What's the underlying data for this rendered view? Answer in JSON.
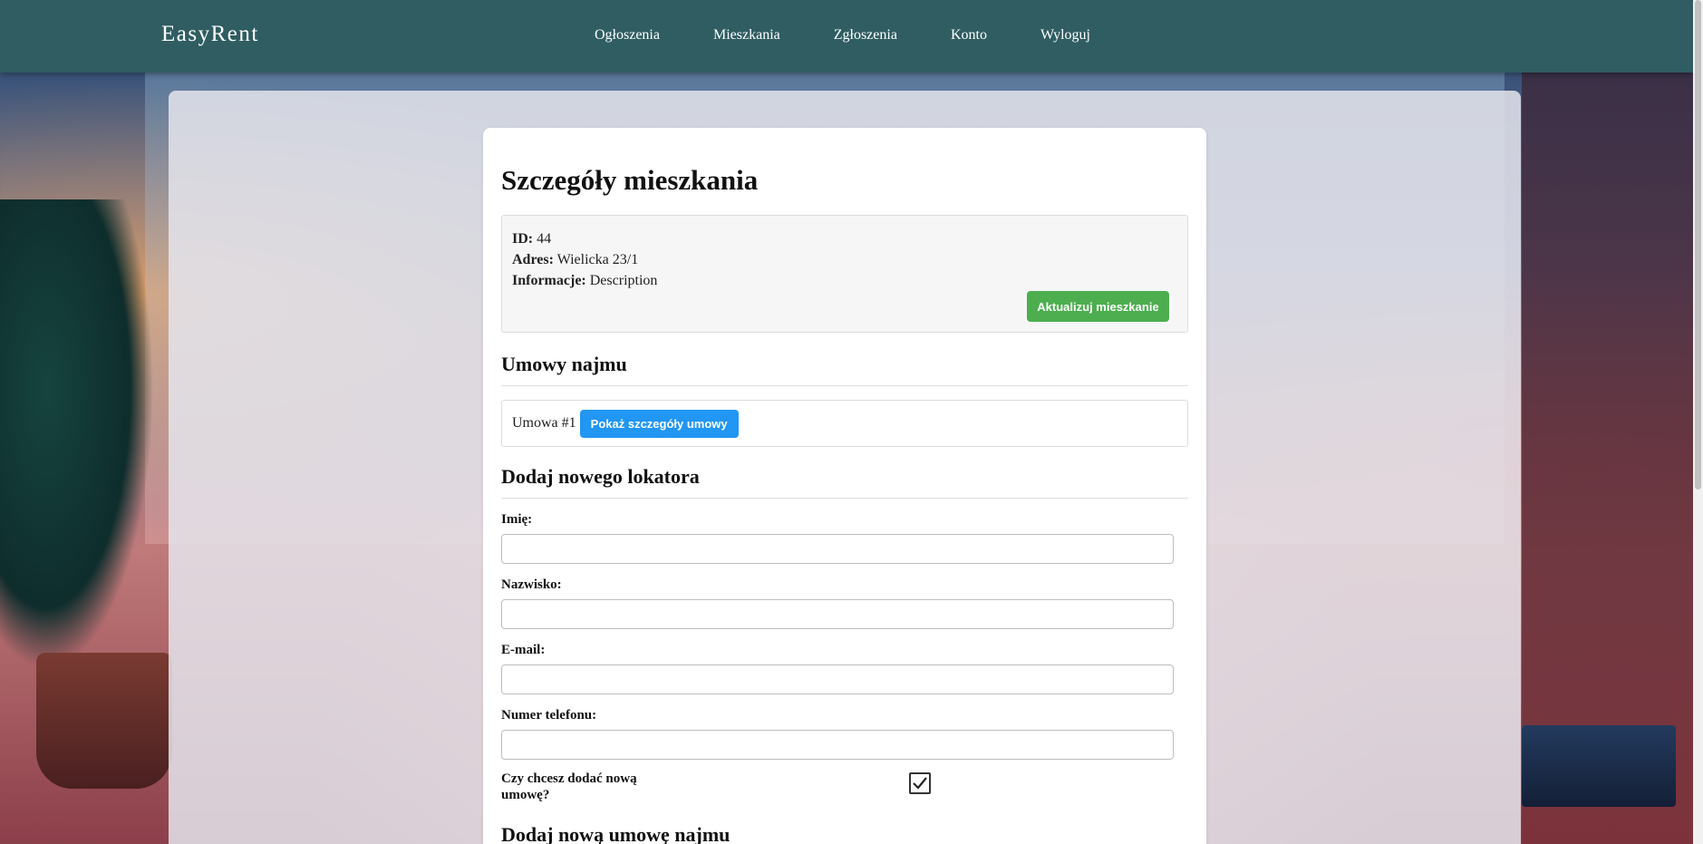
{
  "nav": {
    "brand": "EasyRent",
    "links": [
      "Ogłoszenia",
      "Mieszkania",
      "Zgłoszenia",
      "Konto",
      "Wyloguj"
    ]
  },
  "details": {
    "title": "Szczegóły mieszkania",
    "id_label": "ID:",
    "id_value": "44",
    "address_label": "Adres:",
    "address_value": "Wielicka 23/1",
    "info_label": "Informacje:",
    "info_value": "Description",
    "update_button": "Aktualizuj mieszkanie"
  },
  "contracts": {
    "heading": "Umowy najmu",
    "items": [
      {
        "label": "Umowa #1",
        "button": "Pokaż szczegóły umowy"
      }
    ]
  },
  "tenant_form": {
    "heading": "Dodaj nowego lokatora",
    "first_name_label": "Imię:",
    "last_name_label": "Nazwisko:",
    "email_label": "E-mail:",
    "phone_label": "Numer telefonu:",
    "add_contract_label": "Czy chcesz dodać nową umowę?",
    "add_contract_checked": true
  },
  "new_contract": {
    "heading": "Dodaj nową umowę najmu"
  },
  "colors": {
    "navbar": "#2f5d62",
    "green_button": "#4cae4f",
    "blue_button": "#2196f3"
  }
}
